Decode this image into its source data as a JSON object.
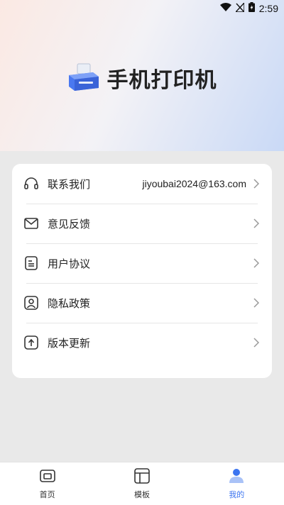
{
  "status_bar": {
    "time": "2:59",
    "icons": [
      "wifi-icon",
      "signal-off-icon",
      "battery-charging-icon"
    ]
  },
  "header": {
    "app_title": "手机打印机",
    "logo_icon": "printer-icon"
  },
  "menu": {
    "items": [
      {
        "label": "联系我们",
        "value": "jiyoubai2024@163.com",
        "icon": "headset-icon"
      },
      {
        "label": "意见反馈",
        "value": "",
        "icon": "mail-icon"
      },
      {
        "label": "用户协议",
        "value": "",
        "icon": "document-icon"
      },
      {
        "label": "隐私政策",
        "value": "",
        "icon": "privacy-icon"
      },
      {
        "label": "版本更新",
        "value": "",
        "icon": "update-icon"
      }
    ]
  },
  "bottom_nav": {
    "tabs": [
      {
        "label": "首页",
        "icon": "home-icon",
        "active": false
      },
      {
        "label": "模板",
        "icon": "template-icon",
        "active": false
      },
      {
        "label": "我的",
        "icon": "profile-icon",
        "active": true
      }
    ]
  },
  "colors": {
    "accent": "#3b74f0",
    "background": "#e9e9e9",
    "card": "#ffffff"
  }
}
